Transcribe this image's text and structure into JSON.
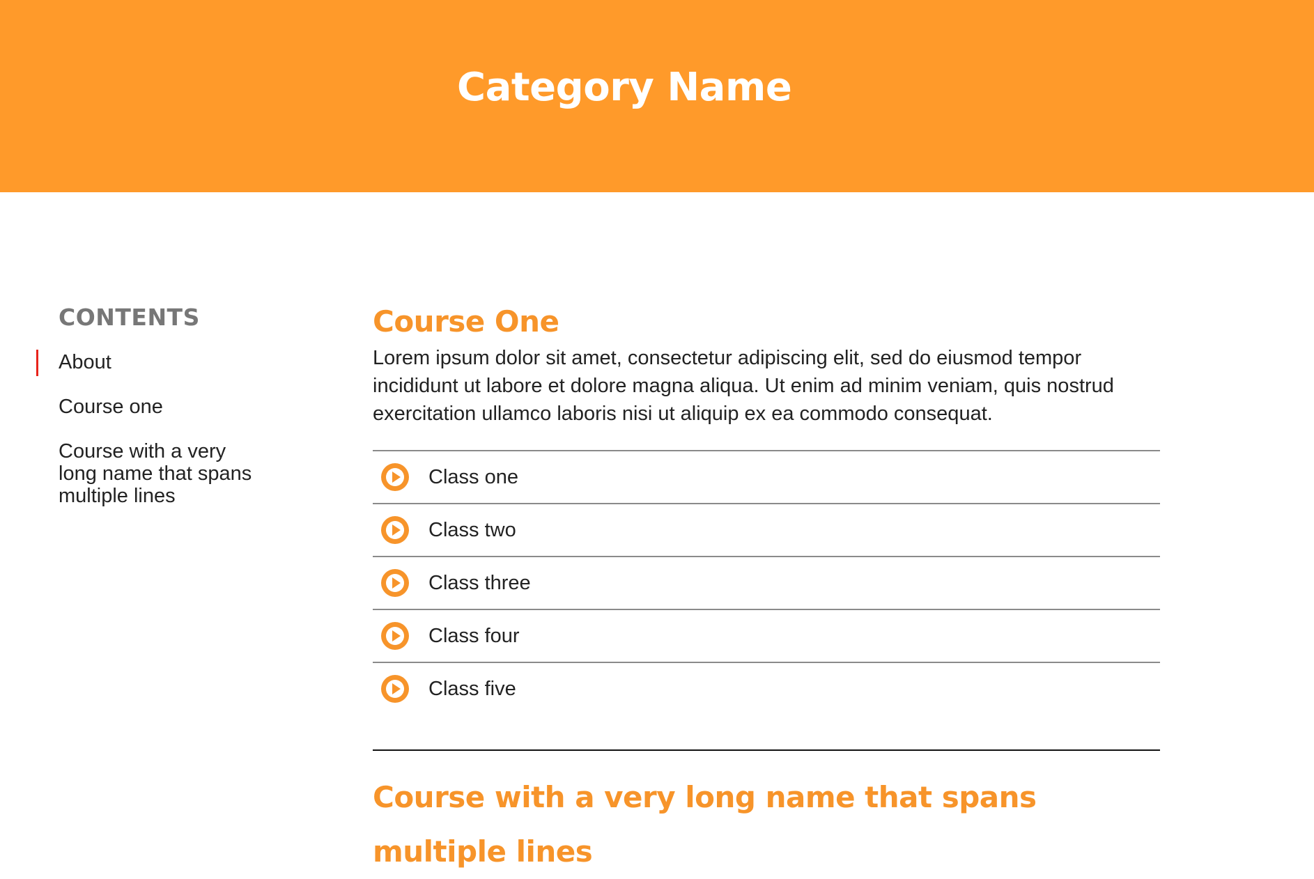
{
  "colors": {
    "banner_background": "#FF9A2A",
    "accent_orange": "#F7942A",
    "active_indicator": "#E8231B",
    "heading_gray": "#777777"
  },
  "banner": {
    "title": "Category Name"
  },
  "sidebar": {
    "heading": "CONTENTS",
    "items": [
      {
        "label": "About",
        "active": true
      },
      {
        "label": "Course one",
        "active": false
      },
      {
        "label": "Course with a very long name that spans multiple lines",
        "active": false
      }
    ]
  },
  "main": {
    "courses": [
      {
        "title": "Course One",
        "description": "Lorem ipsum dolor sit amet, consectetur adipiscing elit, sed do eiusmod tempor incididunt ut labore et dolore magna aliqua. Ut enim ad minim veniam, quis nostrud exercitation ullamco laboris nisi ut aliquip ex ea commodo consequat.",
        "classes": [
          {
            "label": "Class one",
            "icon": "play-circle-icon"
          },
          {
            "label": "Class two",
            "icon": "play-circle-icon"
          },
          {
            "label": "Class three",
            "icon": "play-circle-icon"
          },
          {
            "label": "Class four",
            "icon": "play-circle-icon"
          },
          {
            "label": "Class five",
            "icon": "play-circle-icon"
          }
        ]
      },
      {
        "title": "Course with a very long name that spans multiple lines"
      }
    ]
  }
}
